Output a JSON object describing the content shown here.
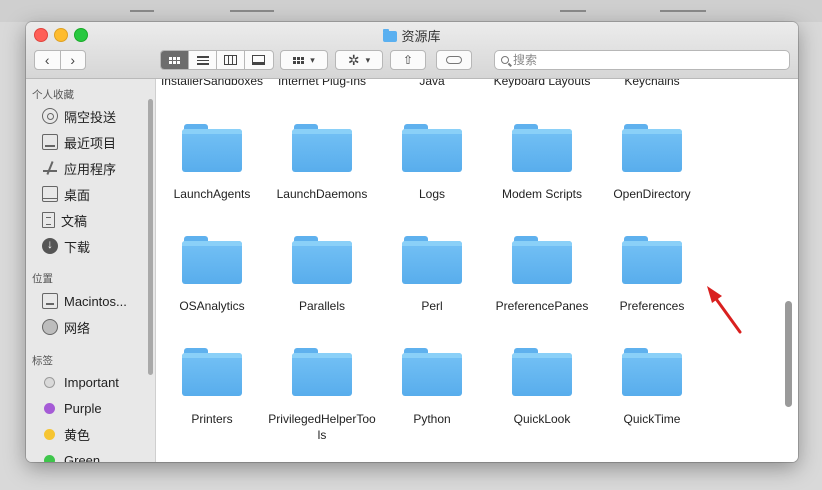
{
  "window": {
    "title": "资源库"
  },
  "toolbar": {
    "back": "‹",
    "forward": "›",
    "search_placeholder": "搜索",
    "action_symbol": "✲",
    "share_symbol": "⇧"
  },
  "sidebar": {
    "sections": [
      {
        "header": "个人收藏",
        "items": [
          {
            "label": "隔空投送",
            "icon": "airdrop-icon"
          },
          {
            "label": "最近项目",
            "icon": "recents-icon"
          },
          {
            "label": "应用程序",
            "icon": "applications-icon"
          },
          {
            "label": "桌面",
            "icon": "desktop-icon"
          },
          {
            "label": "文稿",
            "icon": "documents-icon"
          },
          {
            "label": "下载",
            "icon": "downloads-icon"
          }
        ]
      },
      {
        "header": "位置",
        "items": [
          {
            "label": "Macintos...",
            "icon": "disk-icon"
          },
          {
            "label": "网络",
            "icon": "network-icon"
          }
        ]
      },
      {
        "header": "标签",
        "items": [
          {
            "label": "Important",
            "color": "#d9d9d9"
          },
          {
            "label": "Purple",
            "color": "#a55bd6"
          },
          {
            "label": "黄色",
            "color": "#f6c532"
          },
          {
            "label": "Green",
            "color": "#3ec64b"
          }
        ]
      }
    ]
  },
  "folders": {
    "row0": [
      "InstallerSandboxes",
      "Internet Plug-Ins",
      "Java",
      "Keyboard Layouts",
      "Keychains"
    ],
    "row1": [
      "LaunchAgents",
      "LaunchDaemons",
      "Logs",
      "Modem Scripts",
      "OpenDirectory"
    ],
    "row2": [
      "OSAnalytics",
      "Parallels",
      "Perl",
      "PreferencePanes",
      "Preferences"
    ],
    "row3": [
      "Printers",
      "PrivilegedHelperTools",
      "Python",
      "QuickLook",
      "QuickTime"
    ]
  },
  "colors": {
    "folder": "#5fb1ee",
    "annotation_arrow": "#d9201f"
  }
}
